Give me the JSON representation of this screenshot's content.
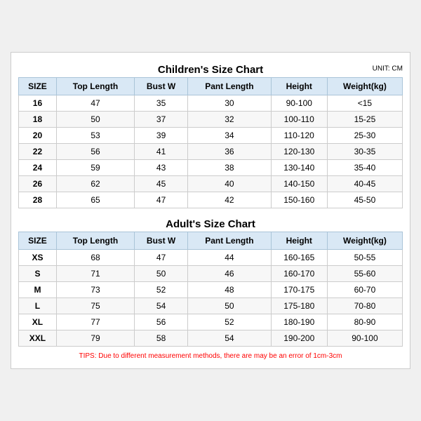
{
  "children_section": {
    "title": "Children's Size Chart",
    "unit": "UNIT: CM",
    "headers": [
      "SIZE",
      "Top Length",
      "Bust W",
      "Pant Length",
      "Height",
      "Weight(kg)"
    ],
    "rows": [
      [
        "16",
        "47",
        "35",
        "30",
        "90-100",
        "<15"
      ],
      [
        "18",
        "50",
        "37",
        "32",
        "100-110",
        "15-25"
      ],
      [
        "20",
        "53",
        "39",
        "34",
        "110-120",
        "25-30"
      ],
      [
        "22",
        "56",
        "41",
        "36",
        "120-130",
        "30-35"
      ],
      [
        "24",
        "59",
        "43",
        "38",
        "130-140",
        "35-40"
      ],
      [
        "26",
        "62",
        "45",
        "40",
        "140-150",
        "40-45"
      ],
      [
        "28",
        "65",
        "47",
        "42",
        "150-160",
        "45-50"
      ]
    ]
  },
  "adults_section": {
    "title": "Adult's Size Chart",
    "headers": [
      "SIZE",
      "Top Length",
      "Bust W",
      "Pant Length",
      "Height",
      "Weight(kg)"
    ],
    "rows": [
      [
        "XS",
        "68",
        "47",
        "44",
        "160-165",
        "50-55"
      ],
      [
        "S",
        "71",
        "50",
        "46",
        "160-170",
        "55-60"
      ],
      [
        "M",
        "73",
        "52",
        "48",
        "170-175",
        "60-70"
      ],
      [
        "L",
        "75",
        "54",
        "50",
        "175-180",
        "70-80"
      ],
      [
        "XL",
        "77",
        "56",
        "52",
        "180-190",
        "80-90"
      ],
      [
        "XXL",
        "79",
        "58",
        "54",
        "190-200",
        "90-100"
      ]
    ]
  },
  "tips": "TIPS: Due to different measurement methods, there are may be an error of 1cm-3cm"
}
